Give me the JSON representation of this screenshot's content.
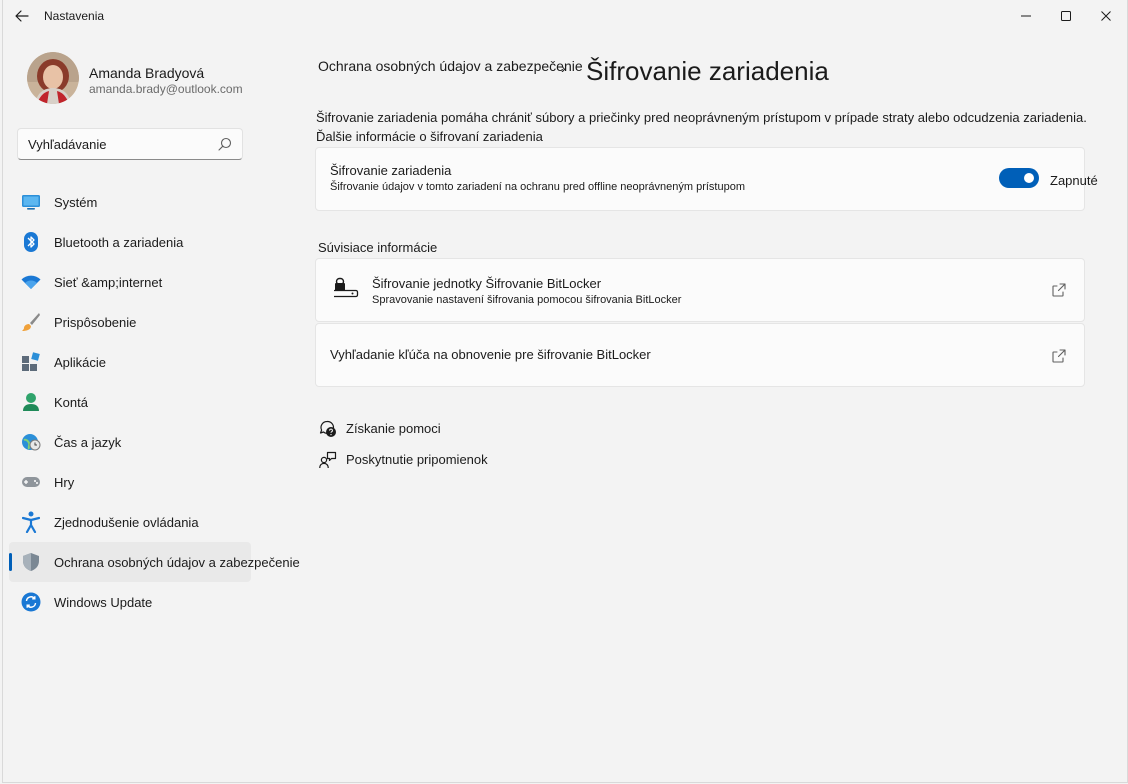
{
  "window": {
    "title": "Nastavenia",
    "back_icon": "arrow-left-icon",
    "controls": [
      "minimize-icon",
      "maximize-icon",
      "close-icon"
    ]
  },
  "profile": {
    "name": "Amanda Bradyová",
    "email": "amanda.brady@outlook.com"
  },
  "search": {
    "placeholder": "Vyhľadávanie",
    "icon": "search-icon"
  },
  "sidebar": {
    "items": [
      {
        "label": "Systém",
        "icon": "system-icon",
        "active": false
      },
      {
        "label": "Bluetooth a zariadenia",
        "icon": "bluetooth-icon",
        "active": false
      },
      {
        "label": "Sieť &amp;internet",
        "icon": "wifi-icon",
        "active": false
      },
      {
        "label": "Prispôsobenie",
        "icon": "brush-icon",
        "active": false
      },
      {
        "label": "Aplikácie",
        "icon": "apps-icon",
        "active": false
      },
      {
        "label": "Kontá",
        "icon": "account-icon",
        "active": false
      },
      {
        "label": "Čas a jazyk",
        "icon": "time-language-icon",
        "active": false
      },
      {
        "label": "Hry",
        "icon": "gamepad-icon",
        "active": false
      },
      {
        "label": "Zjednodušenie ovládania",
        "icon": "accessibility-icon",
        "active": false
      },
      {
        "label": "Ochrana osobných údajov a zabezpečenie",
        "icon": "shield-icon",
        "active": true
      },
      {
        "label": "Windows Update",
        "icon": "windows-update-icon",
        "active": false
      }
    ],
    "accent_color": "#005fb8"
  },
  "main": {
    "breadcrumb_parent": "Ochrana osobných údajov a zabezpečenie",
    "breadcrumb_separator": "›",
    "title": "Šifrovanie zariadenia",
    "description": "Šifrovanie zariadenia pomáha chrániť súbory a priečinky pred neoprávneným prístupom v prípade straty alebo odcudzenia zariadenia. Ďalšie informácie o šifrovaní zariadenia",
    "encryption_card": {
      "title": "Šifrovanie zariadenia",
      "subtitle": "Šifrovanie údajov v tomto zariadení na ochranu pred offline neoprávneným prístupom",
      "toggle_on": true,
      "toggle_label": "Zapnuté"
    },
    "related_heading": "Súvisiace informácie",
    "related": [
      {
        "title": "Šifrovanie jednotky Šifrovanie BitLocker",
        "subtitle": "Spravovanie nastavení šifrovania pomocou šifrovania BitLocker",
        "icon": "drive-lock-icon",
        "link_icon": "open-external-icon"
      },
      {
        "title": "Vyhľadanie kľúča na obnovenie pre šifrovanie BitLocker",
        "link_icon": "open-external-icon"
      }
    ],
    "help_links": [
      {
        "label": "Získanie pomoci",
        "icon": "help-chat-icon"
      },
      {
        "label": "Poskytnutie pripomienok",
        "icon": "feedback-icon"
      }
    ]
  }
}
